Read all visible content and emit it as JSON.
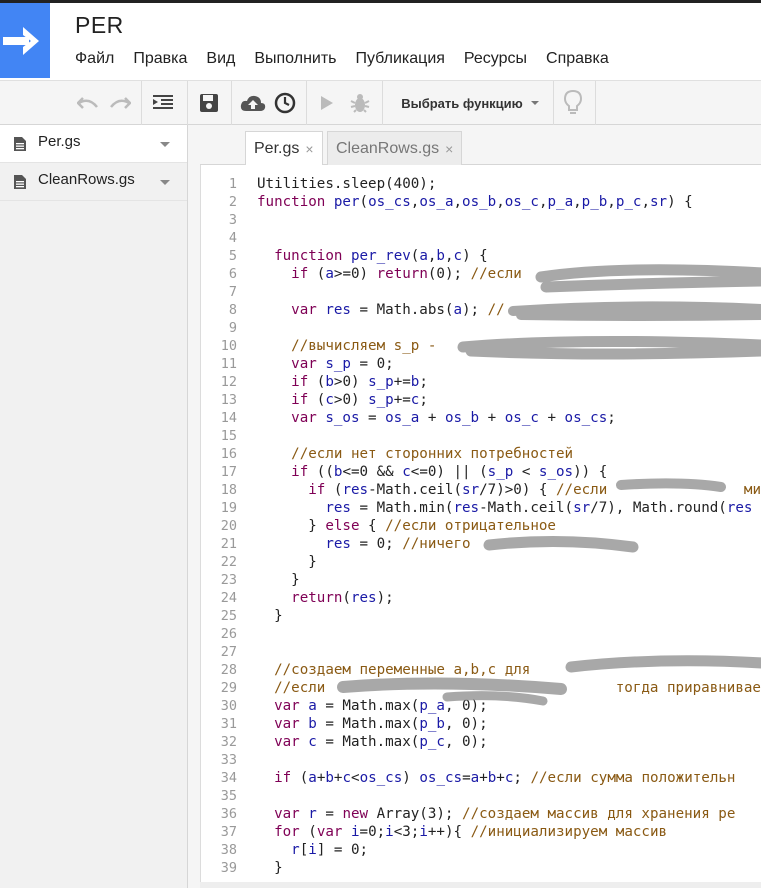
{
  "app": {
    "title": "PER"
  },
  "menu": [
    "Файл",
    "Правка",
    "Вид",
    "Выполнить",
    "Публикация",
    "Ресурсы",
    "Справка"
  ],
  "toolbar": {
    "function_select": "Выбрать функцию"
  },
  "files": [
    {
      "name": "Per.gs",
      "active": true
    },
    {
      "name": "CleanRows.gs",
      "active": false
    }
  ],
  "tabs": [
    {
      "label": "Per.gs",
      "close": "×"
    },
    {
      "label": "CleanRows.gs",
      "close": "×"
    }
  ],
  "colors": {
    "keyword": "#7f0055",
    "identifier": "#1a1aa6",
    "comment": "#8a5a14",
    "number": "#222222",
    "accent": "#4285f4"
  },
  "code_lines": [
    [
      [
        "p",
        "Utilities.sleep(400);"
      ]
    ],
    [
      [
        "k",
        "function"
      ],
      [
        "p",
        " "
      ],
      [
        "v",
        "per"
      ],
      [
        "p",
        "("
      ],
      [
        "v",
        "os_cs"
      ],
      [
        "p",
        ","
      ],
      [
        "v",
        "os_a"
      ],
      [
        "p",
        ","
      ],
      [
        "v",
        "os_b"
      ],
      [
        "p",
        ","
      ],
      [
        "v",
        "os_c"
      ],
      [
        "p",
        ","
      ],
      [
        "v",
        "p_a"
      ],
      [
        "p",
        ","
      ],
      [
        "v",
        "p_b"
      ],
      [
        "p",
        ","
      ],
      [
        "v",
        "p_c"
      ],
      [
        "p",
        ","
      ],
      [
        "v",
        "sr"
      ],
      [
        "p",
        ") {"
      ]
    ],
    [],
    [],
    [
      [
        "p",
        "  "
      ],
      [
        "k",
        "function"
      ],
      [
        "p",
        " "
      ],
      [
        "v",
        "per_rev"
      ],
      [
        "p",
        "("
      ],
      [
        "v",
        "a"
      ],
      [
        "p",
        ","
      ],
      [
        "v",
        "b"
      ],
      [
        "p",
        ","
      ],
      [
        "v",
        "c"
      ],
      [
        "p",
        ") {"
      ]
    ],
    [
      [
        "p",
        "    "
      ],
      [
        "k",
        "if"
      ],
      [
        "p",
        " ("
      ],
      [
        "v",
        "a"
      ],
      [
        "p",
        ">=0) "
      ],
      [
        "k",
        "return"
      ],
      [
        "p",
        "(0); "
      ],
      [
        "c",
        "//если"
      ]
    ],
    [],
    [
      [
        "p",
        "    "
      ],
      [
        "k",
        "var"
      ],
      [
        "p",
        " "
      ],
      [
        "v",
        "res"
      ],
      [
        "p",
        " = Math.abs("
      ],
      [
        "v",
        "a"
      ],
      [
        "p",
        "); "
      ],
      [
        "c",
        "//"
      ]
    ],
    [],
    [
      [
        "p",
        "    "
      ],
      [
        "c",
        "//вычисляем s_p -"
      ]
    ],
    [
      [
        "p",
        "    "
      ],
      [
        "k",
        "var"
      ],
      [
        "p",
        " "
      ],
      [
        "v",
        "s_p"
      ],
      [
        "p",
        " = 0;"
      ]
    ],
    [
      [
        "p",
        "    "
      ],
      [
        "k",
        "if"
      ],
      [
        "p",
        " ("
      ],
      [
        "v",
        "b"
      ],
      [
        "p",
        ">0) "
      ],
      [
        "v",
        "s_p"
      ],
      [
        "p",
        "+="
      ],
      [
        "v",
        "b"
      ],
      [
        "p",
        ";"
      ]
    ],
    [
      [
        "p",
        "    "
      ],
      [
        "k",
        "if"
      ],
      [
        "p",
        " ("
      ],
      [
        "v",
        "c"
      ],
      [
        "p",
        ">0) "
      ],
      [
        "v",
        "s_p"
      ],
      [
        "p",
        "+="
      ],
      [
        "v",
        "c"
      ],
      [
        "p",
        ";"
      ]
    ],
    [
      [
        "p",
        "    "
      ],
      [
        "k",
        "var"
      ],
      [
        "p",
        " "
      ],
      [
        "v",
        "s_os"
      ],
      [
        "p",
        " = "
      ],
      [
        "v",
        "os_a"
      ],
      [
        "p",
        " + "
      ],
      [
        "v",
        "os_b"
      ],
      [
        "p",
        " + "
      ],
      [
        "v",
        "os_c"
      ],
      [
        "p",
        " + "
      ],
      [
        "v",
        "os_cs"
      ],
      [
        "p",
        ";"
      ]
    ],
    [],
    [
      [
        "p",
        "    "
      ],
      [
        "c",
        "//если нет сторонних потребностей"
      ]
    ],
    [
      [
        "p",
        "    "
      ],
      [
        "k",
        "if"
      ],
      [
        "p",
        " (("
      ],
      [
        "v",
        "b"
      ],
      [
        "p",
        "<=0 && "
      ],
      [
        "v",
        "c"
      ],
      [
        "p",
        "<=0) || ("
      ],
      [
        "v",
        "s_p"
      ],
      [
        "p",
        " < "
      ],
      [
        "v",
        "s_os"
      ],
      [
        "p",
        ")) {"
      ]
    ],
    [
      [
        "p",
        "      "
      ],
      [
        "k",
        "if"
      ],
      [
        "p",
        " ("
      ],
      [
        "v",
        "res"
      ],
      [
        "p",
        "-Math.ceil("
      ],
      [
        "v",
        "sr"
      ],
      [
        "p",
        "/7)>0) { "
      ],
      [
        "c",
        "//если                ми"
      ]
    ],
    [
      [
        "p",
        "        "
      ],
      [
        "v",
        "res"
      ],
      [
        "p",
        " = Math.min("
      ],
      [
        "v",
        "res"
      ],
      [
        "p",
        "-Math.ceil("
      ],
      [
        "v",
        "sr"
      ],
      [
        "p",
        "/7), Math.round("
      ],
      [
        "v",
        "res"
      ]
    ],
    [
      [
        "p",
        "      } "
      ],
      [
        "k",
        "else"
      ],
      [
        "p",
        " { "
      ],
      [
        "c",
        "//если отрицательное"
      ]
    ],
    [
      [
        "p",
        "        "
      ],
      [
        "v",
        "res"
      ],
      [
        "p",
        " = 0; "
      ],
      [
        "c",
        "//ничего"
      ]
    ],
    [
      [
        "p",
        "      }"
      ]
    ],
    [
      [
        "p",
        "    }"
      ]
    ],
    [
      [
        "p",
        "    "
      ],
      [
        "k",
        "return"
      ],
      [
        "p",
        "("
      ],
      [
        "v",
        "res"
      ],
      [
        "p",
        ");"
      ]
    ],
    [
      [
        "p",
        "  }"
      ]
    ],
    [],
    [],
    [
      [
        "p",
        "  "
      ],
      [
        "c",
        "//создаем переменные a,b,c для"
      ]
    ],
    [
      [
        "p",
        "  "
      ],
      [
        "c",
        "//если                                  тогда приравниваем"
      ]
    ],
    [
      [
        "p",
        "  "
      ],
      [
        "k",
        "var"
      ],
      [
        "p",
        " "
      ],
      [
        "v",
        "a"
      ],
      [
        "p",
        " = Math.max("
      ],
      [
        "v",
        "p_a"
      ],
      [
        "p",
        ", 0);"
      ]
    ],
    [
      [
        "p",
        "  "
      ],
      [
        "k",
        "var"
      ],
      [
        "p",
        " "
      ],
      [
        "v",
        "b"
      ],
      [
        "p",
        " = Math.max("
      ],
      [
        "v",
        "p_b"
      ],
      [
        "p",
        ", 0);"
      ]
    ],
    [
      [
        "p",
        "  "
      ],
      [
        "k",
        "var"
      ],
      [
        "p",
        " "
      ],
      [
        "v",
        "c"
      ],
      [
        "p",
        " = Math.max("
      ],
      [
        "v",
        "p_c"
      ],
      [
        "p",
        ", 0);"
      ]
    ],
    [],
    [
      [
        "p",
        "  "
      ],
      [
        "k",
        "if"
      ],
      [
        "p",
        " ("
      ],
      [
        "v",
        "a"
      ],
      [
        "p",
        "+"
      ],
      [
        "v",
        "b"
      ],
      [
        "p",
        "+"
      ],
      [
        "v",
        "c"
      ],
      [
        "p",
        "<"
      ],
      [
        "v",
        "os_cs"
      ],
      [
        "p",
        ") "
      ],
      [
        "v",
        "os_cs"
      ],
      [
        "p",
        "="
      ],
      [
        "v",
        "a"
      ],
      [
        "p",
        "+"
      ],
      [
        "v",
        "b"
      ],
      [
        "p",
        "+"
      ],
      [
        "v",
        "c"
      ],
      [
        "p",
        "; "
      ],
      [
        "c",
        "//если сумма положительн"
      ]
    ],
    [],
    [
      [
        "p",
        "  "
      ],
      [
        "k",
        "var"
      ],
      [
        "p",
        " "
      ],
      [
        "v",
        "r"
      ],
      [
        "p",
        " = "
      ],
      [
        "k",
        "new"
      ],
      [
        "p",
        " Array(3); "
      ],
      [
        "c",
        "//создаем массив для хранения ре"
      ]
    ],
    [
      [
        "p",
        "  "
      ],
      [
        "k",
        "for"
      ],
      [
        "p",
        " ("
      ],
      [
        "k",
        "var"
      ],
      [
        "p",
        " "
      ],
      [
        "v",
        "i"
      ],
      [
        "p",
        "=0;"
      ],
      [
        "v",
        "i"
      ],
      [
        "p",
        "<3;"
      ],
      [
        "v",
        "i"
      ],
      [
        "p",
        "++){ "
      ],
      [
        "c",
        "//инициализируем массив"
      ]
    ],
    [
      [
        "p",
        "    "
      ],
      [
        "v",
        "r"
      ],
      [
        "p",
        "["
      ],
      [
        "v",
        "i"
      ],
      [
        "p",
        "] = 0;"
      ]
    ],
    [
      [
        "p",
        "  }"
      ]
    ]
  ]
}
